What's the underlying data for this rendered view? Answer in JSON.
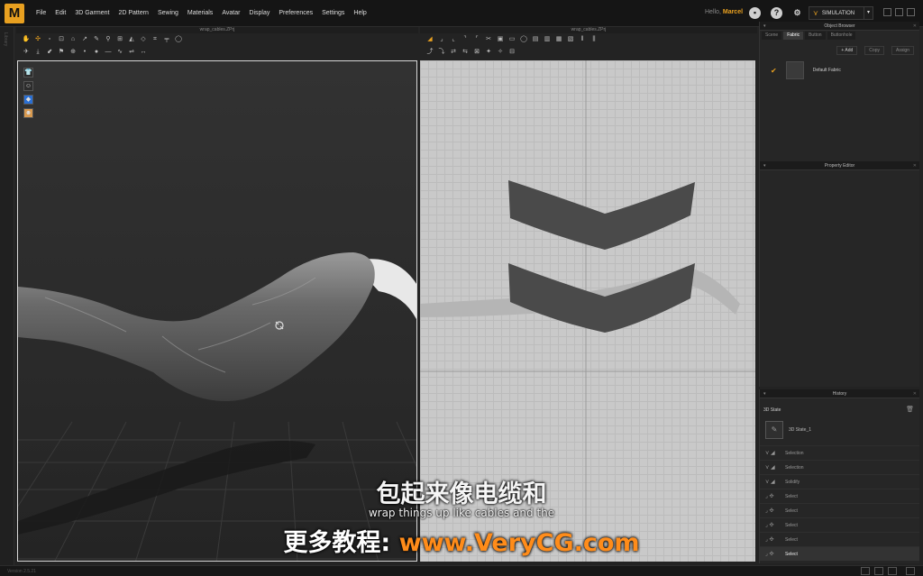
{
  "app": {
    "logo_letter": "M",
    "menu": [
      "File",
      "Edit",
      "3D Garment",
      "2D Pattern",
      "Sewing",
      "Materials",
      "Avatar",
      "Display",
      "Preferences",
      "Settings",
      "Help"
    ],
    "user_prefix": "Hello,",
    "user_name": "Marcel",
    "mode_button": "SIMULATION",
    "accent_color": "#e8a020"
  },
  "left_strip": {
    "label": "Library"
  },
  "view3d": {
    "title": "wrap_cables.ZPrj",
    "side_icons": [
      "garment-icon",
      "avatar-icon",
      "texture-icon",
      "skin-icon"
    ]
  },
  "view2d": {
    "title": "wrap_cables.ZPrj"
  },
  "object_browser": {
    "title": "Object Browser",
    "tabs": [
      "Scene",
      "Fabric",
      "Button",
      "Buttonhole"
    ],
    "active_tab": "Fabric",
    "actions": [
      "+ Add",
      "Copy",
      "Assign"
    ],
    "fabric_item": "Default Fabric"
  },
  "property_editor": {
    "title": "Property Editor"
  },
  "history": {
    "title": "History",
    "section": "3D State",
    "state_item": "3D State_1",
    "items": [
      {
        "icon": "selection-icon",
        "label": "Selection",
        "active": false
      },
      {
        "icon": "selection-icon",
        "label": "Selection",
        "active": false
      },
      {
        "icon": "solidify-icon",
        "label": "Solidify",
        "active": false
      },
      {
        "icon": "select-icon",
        "label": "Select",
        "active": false
      },
      {
        "icon": "select-icon",
        "label": "Select",
        "active": false
      },
      {
        "icon": "select-icon",
        "label": "Select",
        "active": false
      },
      {
        "icon": "select-icon",
        "label": "Select",
        "active": false
      },
      {
        "icon": "select-icon",
        "label": "Select",
        "active": true
      }
    ]
  },
  "status": {
    "label": "Version 2.5.21"
  },
  "subtitles": {
    "zh": "包起来像电缆和",
    "en": "wrap things up like cables and the",
    "watermark_prefix": "更多教程:",
    "watermark_url": "www.VeryCG.com"
  }
}
